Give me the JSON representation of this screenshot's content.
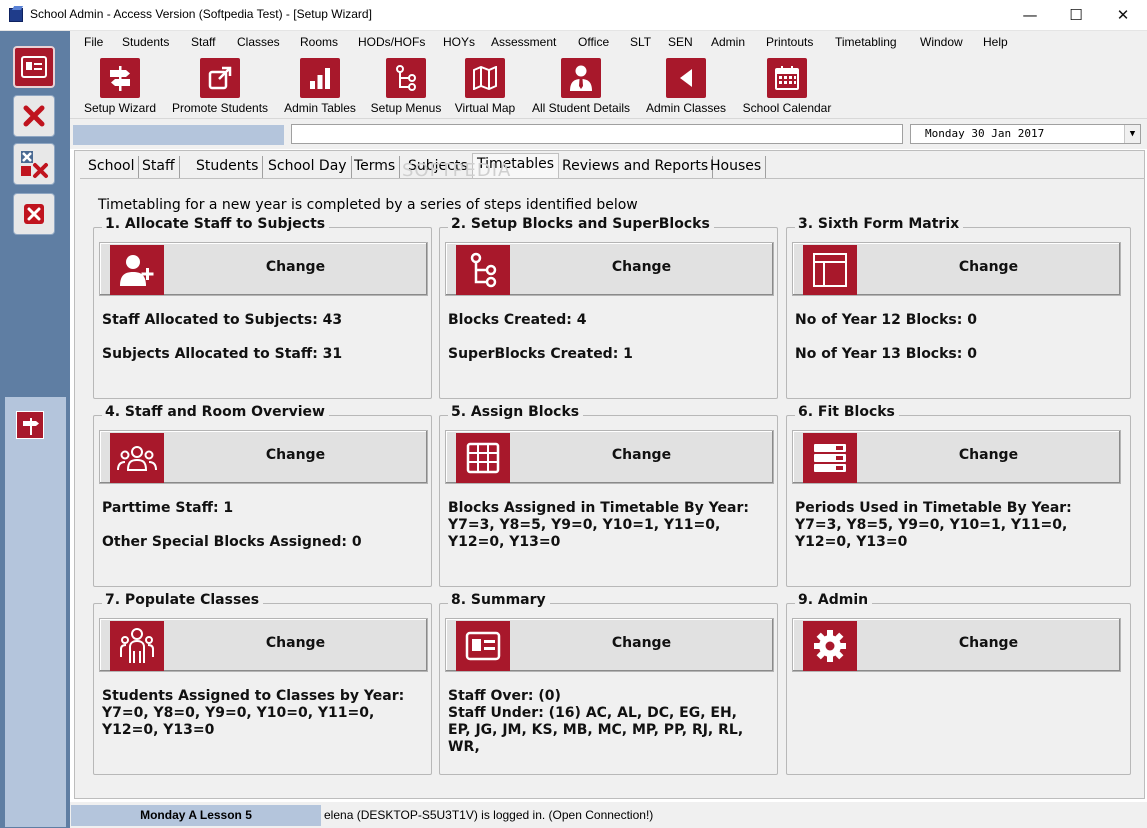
{
  "window": {
    "title": "School Admin - Access Version (Softpedia Test) - [Setup Wizard]",
    "minimize": "—",
    "maximize": "☐",
    "close": "✕"
  },
  "menu": [
    "File",
    "Students",
    "Staff",
    "Classes",
    "Rooms",
    "HODs/HOFs",
    "HOYs",
    "Assessment",
    "Office",
    "SLT",
    "SEN",
    "Admin",
    "Printouts",
    "Timetabling",
    "Window",
    "Help"
  ],
  "toolbar": [
    {
      "label": "Setup Wizard",
      "icon": "signpost-icon"
    },
    {
      "label": "Promote Students",
      "icon": "external-arrow-icon"
    },
    {
      "label": "Admin Tables",
      "icon": "bar-chart-icon"
    },
    {
      "label": "Setup Menus",
      "icon": "flow-icon"
    },
    {
      "label": "Virtual Map",
      "icon": "map-icon"
    },
    {
      "label": "All Student Details",
      "icon": "person-tie-icon"
    },
    {
      "label": "Admin Classes",
      "icon": "back-arrow-icon"
    },
    {
      "label": "School Calendar",
      "icon": "calendar-icon"
    }
  ],
  "date_select": {
    "value": "Monday   30 Jan 2017"
  },
  "tabs": [
    "School",
    "Staff",
    "Students",
    "School Day",
    "Terms",
    "Subjects",
    "Timetables",
    "Reviews and Reports",
    "Houses"
  ],
  "active_tab": "Timetables",
  "watermark": "SOFTPEDIA",
  "intro": "Timetabling for a new year is completed by a series of steps identified below",
  "button_label": "Change",
  "groups": [
    {
      "title": "1. Allocate Staff to Subjects",
      "icon": "add-user-icon",
      "lines": [
        "Staff Allocated to Subjects: 43",
        "Subjects Allocated to Staff: 31"
      ]
    },
    {
      "title": "2. Setup Blocks and SuperBlocks",
      "icon": "flow-icon",
      "lines": [
        "Blocks Created: 4",
        "SuperBlocks Created: 1"
      ]
    },
    {
      "title": "3. Sixth Form Matrix",
      "icon": "layout-icon",
      "lines": [
        "No of Year 12 Blocks: 0",
        "No of Year 13 Blocks: 0"
      ]
    },
    {
      "title": "4. Staff and Room Overview",
      "icon": "group-icon",
      "lines": [
        "Parttime Staff: 1",
        "Other Special Blocks Assigned:  0"
      ]
    },
    {
      "title": "5. Assign Blocks",
      "icon": "grid-icon",
      "lines": [
        "Blocks Assigned in Timetable By Year:\nY7=3, Y8=5, Y9=0, Y10=1, Y11=0,\nY12=0, Y13=0"
      ]
    },
    {
      "title": "6. Fit Blocks",
      "icon": "list-icon",
      "lines": [
        "Periods Used in Timetable By Year:\nY7=3, Y8=5, Y9=0, Y10=1, Y11=0,\nY12=0, Y13=0"
      ]
    },
    {
      "title": "7. Populate Classes",
      "icon": "class-icon",
      "lines": [
        "Students Assigned to Classes by Year:\nY7=0, Y8=0, Y9=0, Y10=0, Y11=0,\nY12=0, Y13=0"
      ]
    },
    {
      "title": "8. Summary",
      "icon": "id-card-icon",
      "lines": [
        "Staff Over: (0)\nStaff Under: (16) AC, AL, DC, EG, EH,\nEP, JG, JM, KS, MB, MC, MP, PP, RJ, RL,\nWR,"
      ]
    },
    {
      "title": "9. Admin",
      "icon": "gear-icon",
      "lines": []
    }
  ],
  "status": {
    "lesson": "Monday A Lesson 5",
    "message": "elena (DESKTOP-S5U3T1V) is logged in. (Open Connection!)"
  },
  "colors": {
    "accent": "#a8182b",
    "rail": "#5f7ea3",
    "rail_light": "#b4c5dc"
  }
}
